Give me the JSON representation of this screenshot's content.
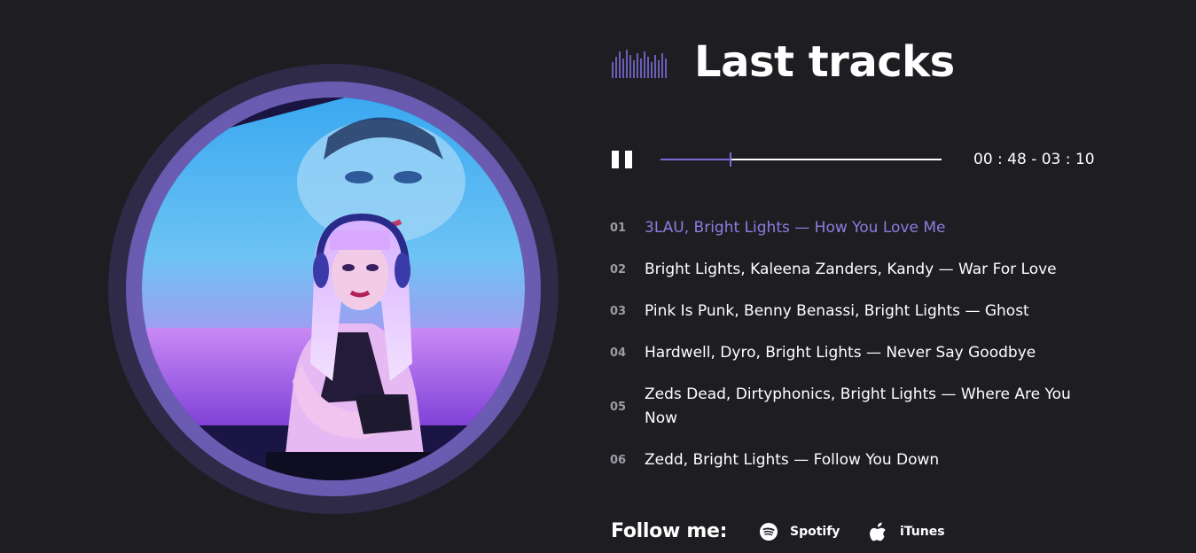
{
  "header": {
    "title": "Last tracks",
    "icon": "equalizer-icon"
  },
  "player": {
    "state_icon": "pause-icon",
    "progress_fraction": 0.25,
    "time_text": "00 : 48 - 03 : 10",
    "accent_color": "#7b6ad6"
  },
  "tracks": [
    {
      "num": "01",
      "name": "3LAU, Bright Lights — How You Love Me",
      "active": true
    },
    {
      "num": "02",
      "name": "Bright Lights, Kaleena Zanders, Kandy — War For Love",
      "active": false
    },
    {
      "num": "03",
      "name": "Pink Is Punk, Benny Benassi, Bright Lights — Ghost",
      "active": false
    },
    {
      "num": "04",
      "name": "Hardwell, Dyro, Bright Lights — Never Say Goodbye",
      "active": false
    },
    {
      "num": "05",
      "name": "Zeds Dead, Dirtyphonics, Bright Lights — Where Are You Now",
      "active": false
    },
    {
      "num": "06",
      "name": "Zedd, Bright Lights — Follow You Down",
      "active": false
    }
  ],
  "follow": {
    "label": "Follow me:",
    "links": [
      {
        "label": "Spotify",
        "icon": "spotify-icon"
      },
      {
        "label": "iTunes",
        "icon": "apple-icon"
      }
    ]
  }
}
